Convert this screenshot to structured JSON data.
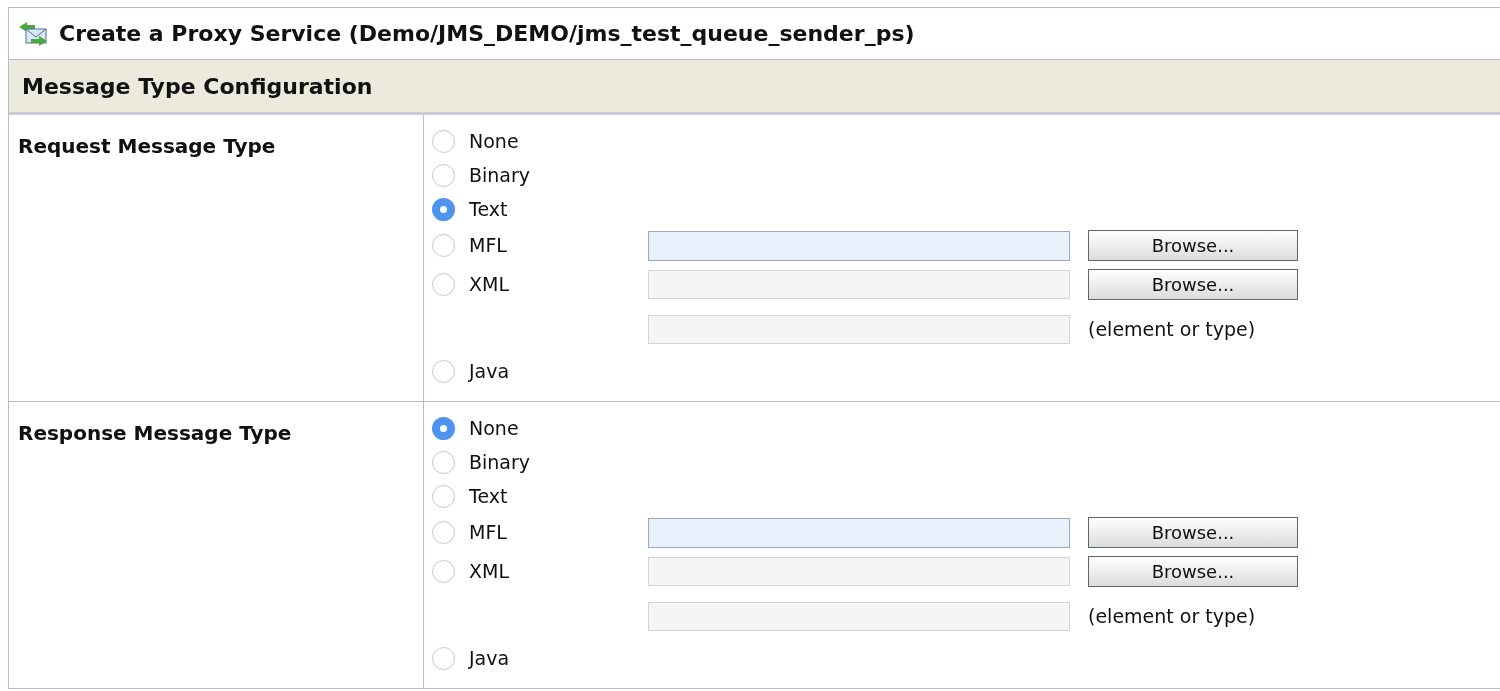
{
  "title": "Create a Proxy Service (Demo/JMS_DEMO/jms_test_queue_sender_ps)",
  "section_header": "Message Type Configuration",
  "sections": [
    {
      "label": "Request Message Type",
      "options": [
        {
          "label": "None",
          "selected": false,
          "kind": "plain"
        },
        {
          "label": "Binary",
          "selected": false,
          "kind": "plain"
        },
        {
          "label": "Text",
          "selected": true,
          "kind": "plain"
        },
        {
          "label": "MFL",
          "selected": false,
          "kind": "browse",
          "field": {
            "disabled": false
          },
          "button": "Browse..."
        },
        {
          "label": "XML",
          "selected": false,
          "kind": "browse",
          "field": {
            "disabled": true
          },
          "button": "Browse...",
          "extra_field": {
            "disabled": true,
            "note": "(element or type)"
          }
        },
        {
          "label": "Java",
          "selected": false,
          "kind": "plain"
        }
      ]
    },
    {
      "label": "Response Message Type",
      "options": [
        {
          "label": "None",
          "selected": true,
          "kind": "plain"
        },
        {
          "label": "Binary",
          "selected": false,
          "kind": "plain"
        },
        {
          "label": "Text",
          "selected": false,
          "kind": "plain"
        },
        {
          "label": "MFL",
          "selected": false,
          "kind": "browse",
          "field": {
            "disabled": false
          },
          "button": "Browse..."
        },
        {
          "label": "XML",
          "selected": false,
          "kind": "browse",
          "field": {
            "disabled": true
          },
          "button": "Browse...",
          "extra_field": {
            "disabled": true,
            "note": "(element or type)"
          }
        },
        {
          "label": "Java",
          "selected": false,
          "kind": "plain"
        }
      ]
    }
  ]
}
